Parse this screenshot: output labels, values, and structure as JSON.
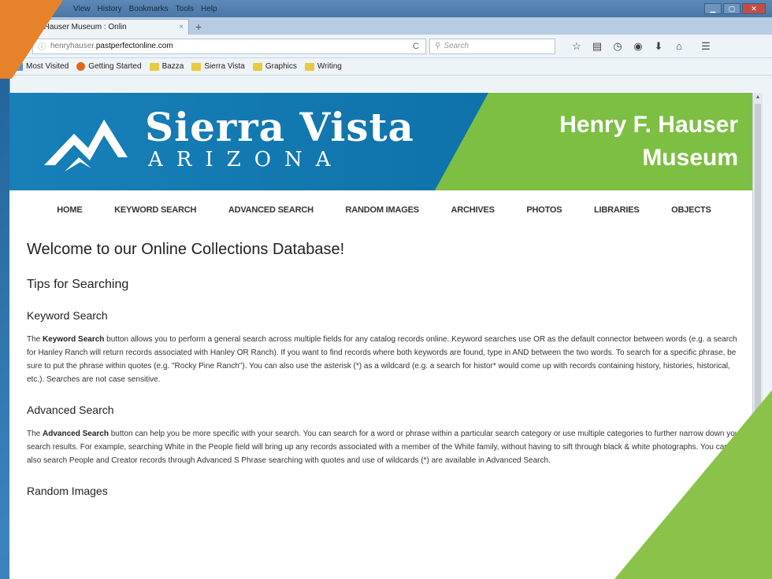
{
  "menu": {
    "view": "View",
    "history": "History",
    "bookmarks": "Bookmarks",
    "tools": "Tools",
    "help": "Help"
  },
  "tab": {
    "title": "ry F. Hauser Museum : Onlin",
    "close": "×",
    "new_tab": "+"
  },
  "urlbar": {
    "info": "ⓘ",
    "url_prefix": "henryhauser.",
    "url_domain": "pastperfectonline.com",
    "reload": "C",
    "search_placeholder": "Search"
  },
  "bookmarks_bar": [
    {
      "label": "Most Visited",
      "icon": "blue"
    },
    {
      "label": "Getting Started",
      "icon": "ff"
    },
    {
      "label": "Bazza",
      "icon": "folder"
    },
    {
      "label": "Sierra Vista",
      "icon": "folder"
    },
    {
      "label": "Graphics",
      "icon": "folder"
    },
    {
      "label": "Writing",
      "icon": "folder"
    }
  ],
  "banner": {
    "city": "Sierra Vista",
    "state": "ARIZONA",
    "museum_line1": "Henry F. Hauser",
    "museum_line2": "Museum"
  },
  "site_nav": [
    "HOME",
    "KEYWORD SEARCH",
    "ADVANCED SEARCH",
    "RANDOM IMAGES",
    "ARCHIVES",
    "PHOTOS",
    "LIBRARIES",
    "OBJECTS"
  ],
  "content": {
    "welcome": "Welcome to our Online Collections Database!",
    "tips": "Tips for Searching",
    "keyword_heading": "Keyword Search",
    "keyword_bold": "Keyword Search",
    "keyword_text": " button allows you to perform a general search across multiple fields for any catalog records online. Keyword searches use OR as the default connector between words (e.g. a search for Hanley Ranch will return records associated with Hanley OR Ranch). If you want to find records where both keywords are found, type in AND between the two words. To search for a specific phrase, be sure to put the phrase within quotes (e.g. \"Rocky Pine Ranch\"). You can also use the asterisk (*) as a wildcard (e.g. a search for histor* would come up with records containing history, histories, historical, etc.). Searches are not case sensitive.",
    "keyword_prefix": "The ",
    "advanced_heading": "Advanced Search",
    "advanced_prefix": "The ",
    "advanced_bold": "Advanced Search",
    "advanced_text": " button can help you be more specific with your search. You can search for a word or phrase within a particular search category or use multiple categories to further narrow down your search results. For example, searching White in the People field will bring up any records associated with a member of the White family, without having to sift through black & white photographs. You can also search People and Creator records through Advanced S Phrase searching with quotes and use of wildcards (*) are available in Advanced Search.",
    "random_heading": "Random Images"
  },
  "colors": {
    "banner_blue": "#1780b8",
    "banner_green": "#7dbf43",
    "slide_orange": "#e8822a",
    "slide_green": "#8bc34a"
  }
}
